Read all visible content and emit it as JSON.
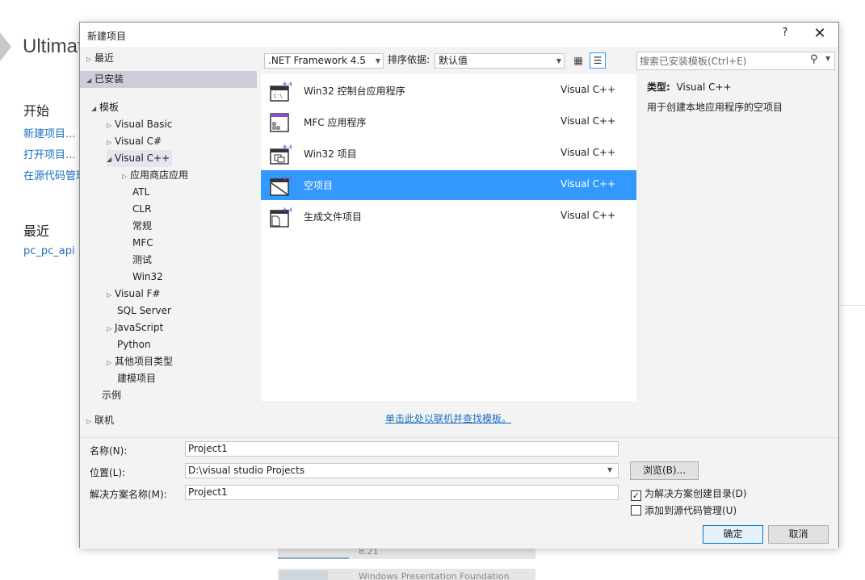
{
  "background": {
    "title": "Ultimat",
    "start_heading": "开始",
    "start_links": [
      "新建项目...",
      "打开项目...",
      "在源代码管理"
    ],
    "recent_heading": "最近",
    "recent_items": [
      "pc_pc_api"
    ],
    "tile1_text": "8.21",
    "tile2_text": "Windows Presentation Foundation"
  },
  "dialog": {
    "title": "新建项目",
    "help_label": "?",
    "close_label": "✕"
  },
  "tree": {
    "recent": "最近",
    "installed": "已安装",
    "templates": "模板",
    "visual_basic": "Visual Basic",
    "visual_csharp": "Visual C#",
    "visual_cpp": "Visual C++",
    "store_apps": "应用商店应用",
    "atl": "ATL",
    "clr": "CLR",
    "general": "常规",
    "mfc": "MFC",
    "test": "测试",
    "win32": "Win32",
    "visual_fsharp": "Visual F#",
    "sql_server": "SQL Server",
    "javascript": "JavaScript",
    "python": "Python",
    "other_types": "其他项目类型",
    "modeling": "建模项目",
    "samples": "示例",
    "online": "联机"
  },
  "toolbar": {
    "framework": ".NET Framework 4.5",
    "sort_label": "排序依据:",
    "sort_value": "默认值",
    "search_placeholder": "搜索已安装模板(Ctrl+E)"
  },
  "templates": [
    {
      "name": "Win32 控制台应用程序",
      "lang": "Visual C++",
      "icon": "console-app-icon"
    },
    {
      "name": "MFC 应用程序",
      "lang": "Visual C++",
      "icon": "mfc-app-icon"
    },
    {
      "name": "Win32 项目",
      "lang": "Visual C++",
      "icon": "win32-project-icon"
    },
    {
      "name": "空项目",
      "lang": "Visual C++",
      "icon": "empty-project-icon"
    },
    {
      "name": "生成文件项目",
      "lang": "Visual C++",
      "icon": "makefile-project-icon"
    }
  ],
  "online_link": "单击此处以联机并查找模板。",
  "details": {
    "type_label": "类型:",
    "type_value": "Visual C++",
    "description": "用于创建本地应用程序的空项目"
  },
  "form": {
    "name_label": "名称(N):",
    "name_value": "Project1",
    "location_label": "位置(L):",
    "location_value": "D:\\visual studio Projects",
    "solution_label": "解决方案名称(M):",
    "solution_value": "Project1",
    "browse_label": "浏览(B)...",
    "create_dir_label": "为解决方案创建目录(D)",
    "add_source_label": "添加到源代码管理(U)",
    "ok_label": "确定",
    "cancel_label": "取消"
  },
  "colors": {
    "selection": "#3399ff",
    "link": "#1a6fc4",
    "tree_selected": "#cccedb"
  }
}
